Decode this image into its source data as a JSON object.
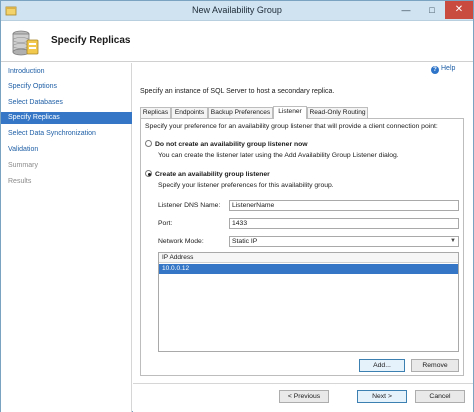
{
  "window": {
    "title": "New Availability Group"
  },
  "titlebar": {
    "minimize": "—",
    "maximize": "□",
    "close": "✕"
  },
  "header": {
    "title": "Specify Replicas"
  },
  "nav": {
    "items": [
      {
        "label": "Introduction",
        "state": "link"
      },
      {
        "label": "Specify Options",
        "state": "link"
      },
      {
        "label": "Select Databases",
        "state": "link"
      },
      {
        "label": "Specify Replicas",
        "state": "active"
      },
      {
        "label": "Select Data Synchronization",
        "state": "link"
      },
      {
        "label": "Validation",
        "state": "link"
      },
      {
        "label": "Summary",
        "state": "disabled"
      },
      {
        "label": "Results",
        "state": "disabled"
      }
    ]
  },
  "main": {
    "help_label": "Help",
    "instruction": "Specify an instance of SQL Server to host a secondary replica.",
    "tabs": [
      {
        "label": "Replicas",
        "active": false
      },
      {
        "label": "Endpoints",
        "active": false
      },
      {
        "label": "Backup Preferences",
        "active": false
      },
      {
        "label": "Listener",
        "active": true
      },
      {
        "label": "Read-Only Routing",
        "active": false
      }
    ]
  },
  "listener": {
    "description": "Specify your preference for an availability group listener that will provide a client connection point:",
    "option_none": {
      "label": "Do not create an availability group listener now",
      "hint": "You can create the listener later using the Add Availability Group Listener dialog.",
      "selected": false
    },
    "option_create": {
      "label": "Create an availability group listener",
      "hint": "Specify your listener preferences for this availability group.",
      "selected": true
    },
    "dns_label": "Listener DNS Name:",
    "dns_value": "ListenerName",
    "port_label": "Port:",
    "port_value": "1433",
    "mode_label": "Network Mode:",
    "mode_value": "Static IP",
    "ip_table": {
      "header": "IP Address",
      "rows": [
        "10.0.0.12"
      ]
    },
    "add_button": "Add...",
    "remove_button": "Remove"
  },
  "footer": {
    "previous": "< Previous",
    "next": "Next >",
    "cancel": "Cancel"
  },
  "colors": {
    "accent": "#3577c6",
    "link": "#1f5fa6",
    "titlebar": "#cfe3f1",
    "close": "#c94a3f"
  }
}
